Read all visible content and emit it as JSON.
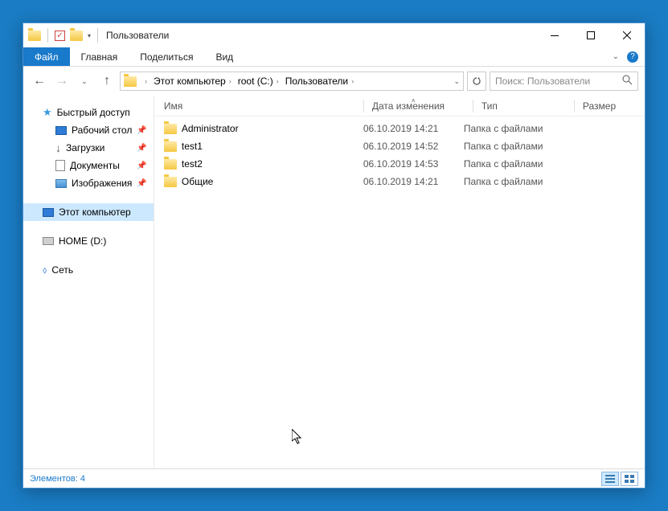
{
  "title": "Пользователи",
  "ribbon": {
    "file": "Файл",
    "tabs": [
      "Главная",
      "Поделиться",
      "Вид"
    ]
  },
  "breadcrumb": {
    "items": [
      "Этот компьютер",
      "root (C:)",
      "Пользователи"
    ]
  },
  "search": {
    "placeholder": "Поиск: Пользователи"
  },
  "sidebar": {
    "quick": "Быстрый доступ",
    "pinned": [
      {
        "label": "Рабочий стол",
        "icon": "desktop"
      },
      {
        "label": "Загрузки",
        "icon": "download"
      },
      {
        "label": "Документы",
        "icon": "doc"
      },
      {
        "label": "Изображения",
        "icon": "image"
      }
    ],
    "thispc": "Этот компьютер",
    "drive": "HOME (D:)",
    "network": "Сеть"
  },
  "columns": {
    "name": "Имя",
    "date": "Дата изменения",
    "type": "Тип",
    "size": "Размер"
  },
  "rows": [
    {
      "name": "Administrator",
      "date": "06.10.2019 14:21",
      "type": "Папка с файлами"
    },
    {
      "name": "test1",
      "date": "06.10.2019 14:52",
      "type": "Папка с файлами"
    },
    {
      "name": "test2",
      "date": "06.10.2019 14:53",
      "type": "Папка с файлами"
    },
    {
      "name": "Общие",
      "date": "06.10.2019 14:21",
      "type": "Папка с файлами"
    }
  ],
  "status": "Элементов: 4"
}
